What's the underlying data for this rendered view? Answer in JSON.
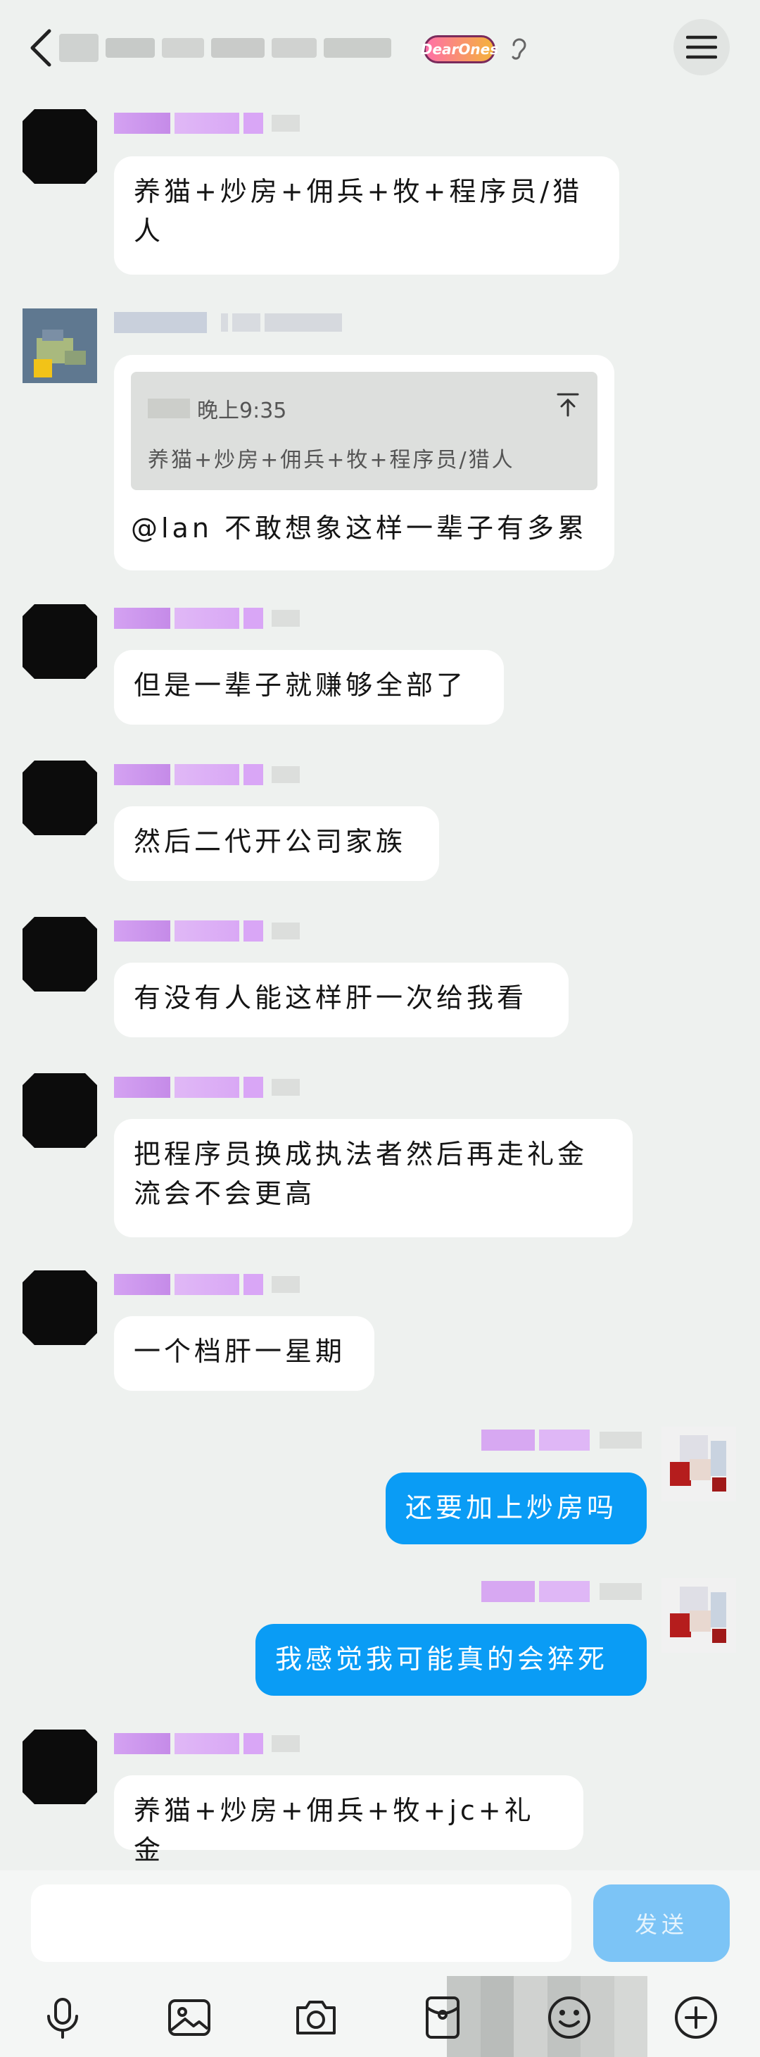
{
  "header": {
    "badge_text": "DearOnes"
  },
  "messages": [
    {
      "side": "left",
      "text": "养猫+炒房+佣兵+牧+程序员/猎人"
    },
    {
      "side": "left",
      "quote": {
        "time": "晚上9:35",
        "text": "养猫+炒房+佣兵+牧+程序员/猎人"
      },
      "text": "@lan 不敢想象这样一辈子有多累"
    },
    {
      "side": "left",
      "text": "但是一辈子就赚够全部了"
    },
    {
      "side": "left",
      "text": "然后二代开公司家族"
    },
    {
      "side": "left",
      "text": "有没有人能这样肝一次给我看"
    },
    {
      "side": "left",
      "text": "把程序员换成执法者然后再走礼金流会不会更高"
    },
    {
      "side": "left",
      "text": "一个档肝一星期"
    },
    {
      "side": "right",
      "text": "还要加上炒房吗"
    },
    {
      "side": "right",
      "text": "我感觉我可能真的会猝死"
    },
    {
      "side": "left",
      "text": "养猫+炒房+佣兵+牧+jc+礼金"
    }
  ],
  "input": {
    "send_label": "发送"
  },
  "toolbar": {
    "icons": [
      "mic-icon",
      "image-icon",
      "camera-icon",
      "red-packet-icon",
      "emoji-icon",
      "plus-icon"
    ]
  },
  "colors": {
    "background": "#eef1ef",
    "my_bubble": "#0a9cf5",
    "send_button": "#7cc4f6"
  }
}
